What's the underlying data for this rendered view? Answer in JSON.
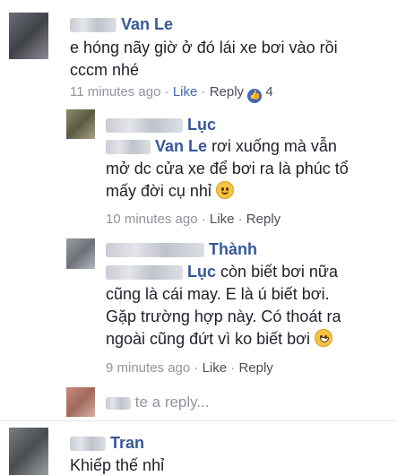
{
  "comments": [
    {
      "author": "Van Le",
      "text_lines": [
        "e hóng nãy giờ ở đó lái xe bơi vào rồi",
        "cccm nhé"
      ],
      "time": "11 minutes ago",
      "like_label": "Like",
      "reply_label": "Reply",
      "reaction_count": "4"
    },
    {
      "author": "Lục",
      "mention": "Van Le",
      "text_lines": [
        "rơi xuống mà vẫn",
        "mở dc cửa xe để bơi ra là phúc tổ",
        "mấy đời cụ nhỉ"
      ],
      "time": "10 minutes ago",
      "like_label": "Like",
      "reply_label": "Reply"
    },
    {
      "author": "Thành",
      "mention": "Lục",
      "text_lines": [
        "còn biết bơi nữa",
        "cũng là cái may. E là ú biết bơi.",
        "Gặp trường hợp này. Có thoát ra",
        "ngoài cũng đứt vì ko biết bơi"
      ],
      "time": "9 minutes ago",
      "like_label": "Like",
      "reply_label": "Reply"
    },
    {
      "author": "Tran",
      "text_lines": [
        "Khiếp thế nhỉ"
      ]
    }
  ],
  "reply_placeholder": "te a reply...",
  "separator": "·",
  "icons": {
    "like": "thumbs-up-icon",
    "emoji1": "grimacing-face-icon",
    "emoji2": "grinning-sweat-icon"
  }
}
